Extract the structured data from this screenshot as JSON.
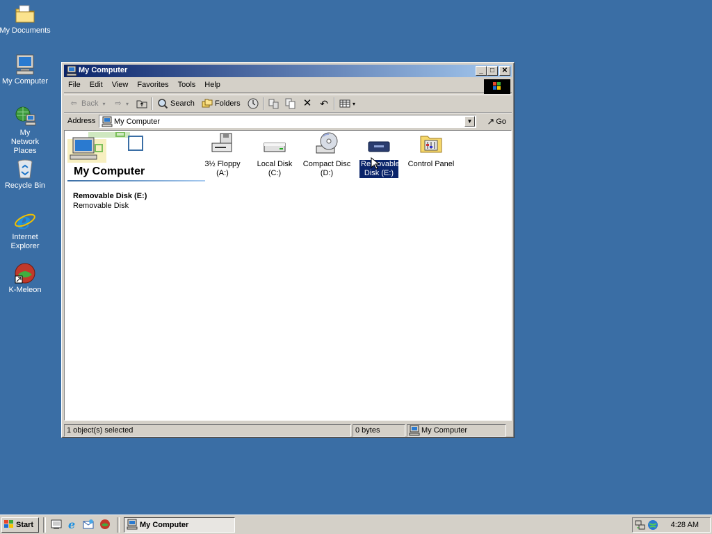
{
  "desktop": {
    "icons": [
      {
        "label": "My Documents",
        "icon": "folder-documents-icon"
      },
      {
        "label": "My Computer",
        "icon": "computer-icon"
      },
      {
        "label": "My Network Places",
        "icon": "network-icon"
      },
      {
        "label": "Recycle Bin",
        "icon": "recycle-bin-icon"
      },
      {
        "label": "Internet Explorer",
        "icon": "ie-icon"
      },
      {
        "label": "K-Meleon",
        "icon": "kmeleon-icon"
      }
    ]
  },
  "window": {
    "title": "My Computer",
    "menu": [
      "File",
      "Edit",
      "View",
      "Favorites",
      "Tools",
      "Help"
    ],
    "toolbar": {
      "back": "Back",
      "search": "Search",
      "folders": "Folders"
    },
    "address": {
      "label": "Address",
      "value": "My Computer",
      "go": "Go"
    },
    "banner_title": "My Computer",
    "selection": {
      "name": "Removable Disk (E:)",
      "type": "Removable Disk"
    },
    "drives": [
      {
        "label": "3½ Floppy (A:)",
        "icon": "floppy-drive-icon",
        "selected": false
      },
      {
        "label": "Local Disk (C:)",
        "icon": "hard-disk-icon",
        "selected": false
      },
      {
        "label": "Compact Disc (D:)",
        "icon": "cd-drive-icon",
        "selected": false
      },
      {
        "label": "Removable Disk (E:)",
        "icon": "removable-disk-icon",
        "selected": true
      },
      {
        "label": "Control Panel",
        "icon": "control-panel-icon",
        "selected": false
      }
    ],
    "status": {
      "objects": "1 object(s) selected",
      "size": "0 bytes",
      "zone": "My Computer"
    }
  },
  "taskbar": {
    "start": "Start",
    "task": "My Computer",
    "clock": "4:28 AM"
  },
  "colors": {
    "desktop": "#3a6ea5",
    "title_start": "#0a246a",
    "title_end": "#a6caf0",
    "face": "#d4d0c8",
    "selection": "#0a246a"
  }
}
